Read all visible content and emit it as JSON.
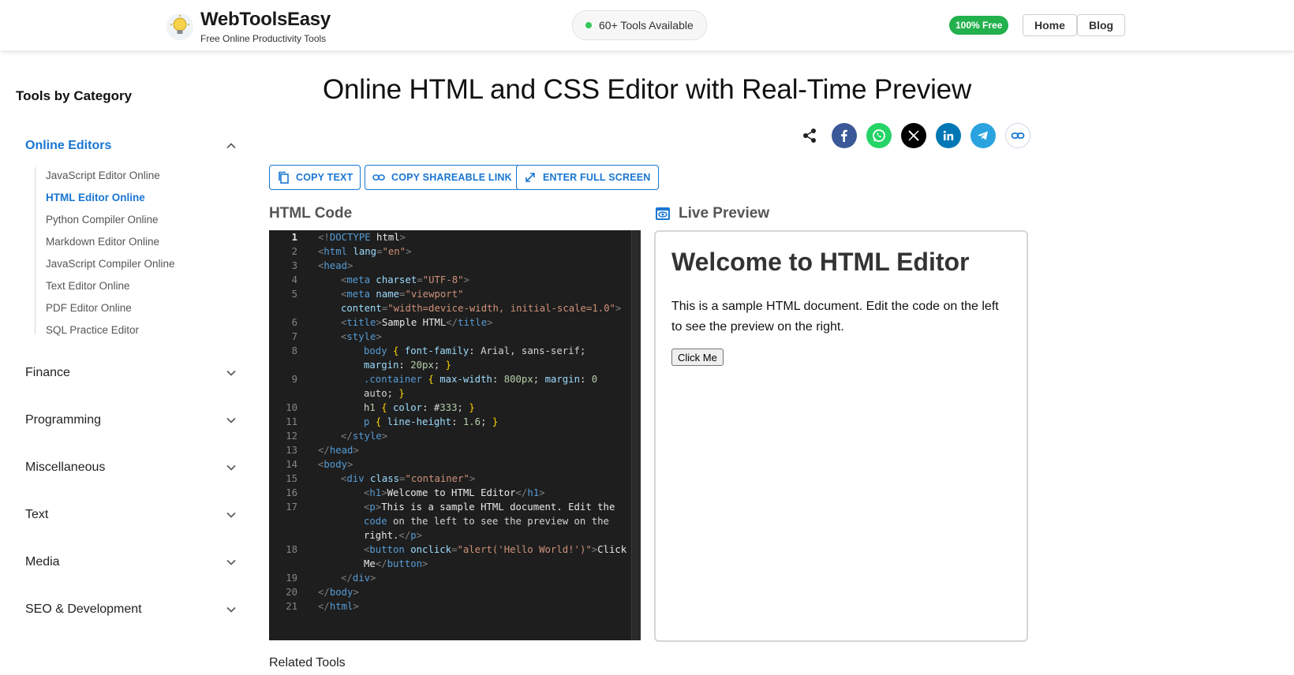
{
  "header": {
    "logo_title": "WebToolsEasy",
    "logo_subtitle": "Free Online Productivity Tools",
    "tools_pill": "60+ Tools Available",
    "free_badge": "100% Free",
    "nav": [
      {
        "label": "Home"
      },
      {
        "label": "Blog"
      }
    ]
  },
  "sidebar": {
    "title": "Tools by Category",
    "categories": [
      {
        "label": "Online Editors",
        "expanded": true
      },
      {
        "label": "Finance"
      },
      {
        "label": "Programming"
      },
      {
        "label": "Miscellaneous"
      },
      {
        "label": "Text"
      },
      {
        "label": "Media"
      },
      {
        "label": "SEO & Development"
      }
    ],
    "online_editors_items": [
      {
        "label": "JavaScript Editor Online"
      },
      {
        "label": "HTML Editor Online",
        "active": true
      },
      {
        "label": "Python Compiler Online"
      },
      {
        "label": "Markdown Editor Online"
      },
      {
        "label": "JavaScript Compiler Online"
      },
      {
        "label": "Text Editor Online"
      },
      {
        "label": "PDF Editor Online"
      },
      {
        "label": "SQL Practice Editor"
      }
    ]
  },
  "main": {
    "title": "Online HTML and CSS Editor with Real-Time Preview",
    "share_icons": [
      "share-icon",
      "facebook-icon",
      "whatsapp-icon",
      "x-icon",
      "linkedin-icon",
      "telegram-icon",
      "link-icon"
    ],
    "actions": {
      "copy_text": "COPY TEXT",
      "copy_link": "COPY SHAREABLE LINK",
      "fullscreen": "ENTER FULL SCREEN"
    },
    "code_label": "HTML Code",
    "preview_label": "Live Preview",
    "line_numbers": [
      "1",
      "2",
      "3",
      "4",
      "5",
      "6",
      "7",
      "8",
      "9",
      "10",
      "11",
      "12",
      "13",
      "14",
      "15",
      "16",
      "17",
      "18",
      "19",
      "20",
      "21"
    ],
    "code_lines": [
      "<!DOCTYPE html>",
      "<html lang=\"en\">",
      "<head>",
      "<meta charset=\"UTF-8\">",
      "<meta name=\"viewport\"",
      "content=\"width=device-width, initial-scale=1.0\">",
      "<title>Sample HTML</title>",
      "<style>",
      "body { font-family: Arial, sans-serif;",
      "margin: 20px; }",
      ".container { max-width: 800px; margin: 0",
      "auto; }",
      "h1 { color: #333; }",
      "p { line-height: 1.6; }",
      "</style>",
      "</head>",
      "<body>",
      "<div class=\"container\">",
      "<h1>Welcome to HTML Editor</h1>",
      "<p>This is a sample HTML document. Edit the",
      "code on the left to see the preview on the",
      "right.</p>",
      "<button onclick=\"alert('Hello World!')\">Click",
      "Me</button>",
      "</div>",
      "</body>",
      "</html>"
    ],
    "preview": {
      "heading": "Welcome to HTML Editor",
      "paragraph": "This is a sample HTML document. Edit the code on the left to see the preview on the right.",
      "button": "Click Me"
    },
    "related_tools": "Related Tools"
  },
  "colors": {
    "accent": "#1976d2",
    "free_badge": "#22b14c",
    "editor_bg": "#1e1e1e"
  }
}
